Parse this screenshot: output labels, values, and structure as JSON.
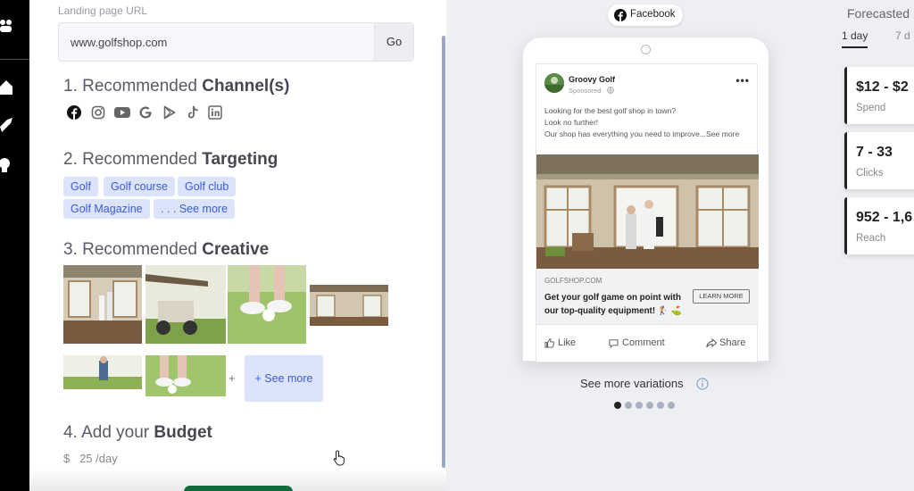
{
  "landing": {
    "label": "Landing page URL",
    "url": "www.golfshop.com",
    "go_label": "Go"
  },
  "sections": {
    "channel_prefix": "1. Recommended ",
    "channel_bold": "Channel(s)",
    "targeting_prefix": "2. Recommended ",
    "targeting_bold": "Targeting",
    "creative_prefix": "3. Recommended ",
    "creative_bold": "Creative",
    "budget_prefix": "4. Add your ",
    "budget_bold": "Budget"
  },
  "channels": [
    "facebook-icon",
    "instagram-icon",
    "youtube-icon",
    "google-icon",
    "google-play-icon",
    "tiktok-icon",
    "linkedin-icon"
  ],
  "targeting_tags": [
    "Golf",
    "Golf course",
    "Golf club",
    "Golf Magazine",
    ". . . See more"
  ],
  "creative": {
    "plus": "+",
    "see_more": "+ See more"
  },
  "budget": {
    "currency": "$",
    "value": "25",
    "unit": "/day"
  },
  "preview": {
    "platform_label": "Facebook",
    "advertiser": "Groovy Golf",
    "sponsored": "Sponsored · ",
    "body_line1": "Looking for the best golf shop in town?",
    "body_line2": "Look no further!",
    "body_line3": "Our shop has everything you need to improve...See more",
    "domain": "GOLFSHOP.COM",
    "headline": "Get your golf game on point with our top-quality equipment! 🏌 ⛳",
    "cta": "LEARN MORE",
    "like": "Like",
    "comment": "Comment",
    "share": "Share",
    "see_variations": "See more variations",
    "carousel_dots": 6,
    "active_dot": 0
  },
  "forecast": {
    "title": "Forecasted",
    "tabs": [
      "1 day",
      "7 d"
    ],
    "active_tab": 0,
    "cards": [
      {
        "value": "$12 - $2",
        "label": "Spend"
      },
      {
        "value": "7 - 33",
        "label": "Clicks"
      },
      {
        "value": "952 - 1,6",
        "label": "Reach"
      }
    ]
  },
  "colors": {
    "accent": "#3b5bd9",
    "tag_bg": "#dbe4fb",
    "sidebar": "#000000",
    "primary_button": "#0f6b3a"
  }
}
